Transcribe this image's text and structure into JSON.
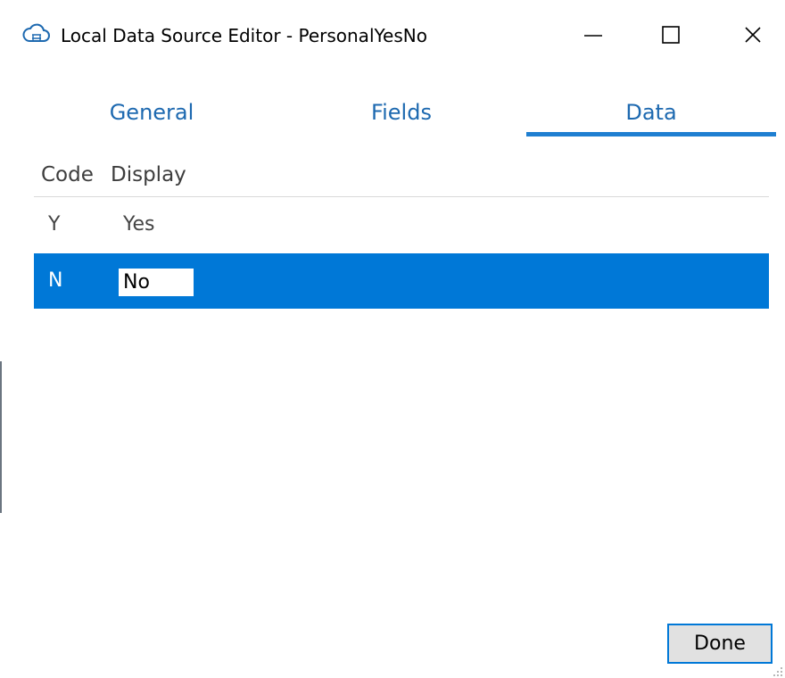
{
  "window": {
    "title": "Local Data Source Editor - PersonalYesNo",
    "icon": "cloud-icon",
    "controls": [
      "minimize-icon",
      "maximize-icon",
      "close-icon"
    ]
  },
  "tabs": [
    {
      "label": "General",
      "selected": false
    },
    {
      "label": "Fields",
      "selected": false
    },
    {
      "label": "Data",
      "selected": true
    }
  ],
  "grid": {
    "columns": [
      "Code",
      "Display"
    ],
    "rows": [
      {
        "code": "Y",
        "display": "Yes",
        "selected": false
      },
      {
        "code": "N",
        "display": "No",
        "selected": true,
        "editing": true
      }
    ]
  },
  "footer": {
    "done_label": "Done"
  },
  "colors": {
    "accent": "#0078d7",
    "tab_text": "#1d69b0",
    "selected_row_text": "#ffffff"
  }
}
